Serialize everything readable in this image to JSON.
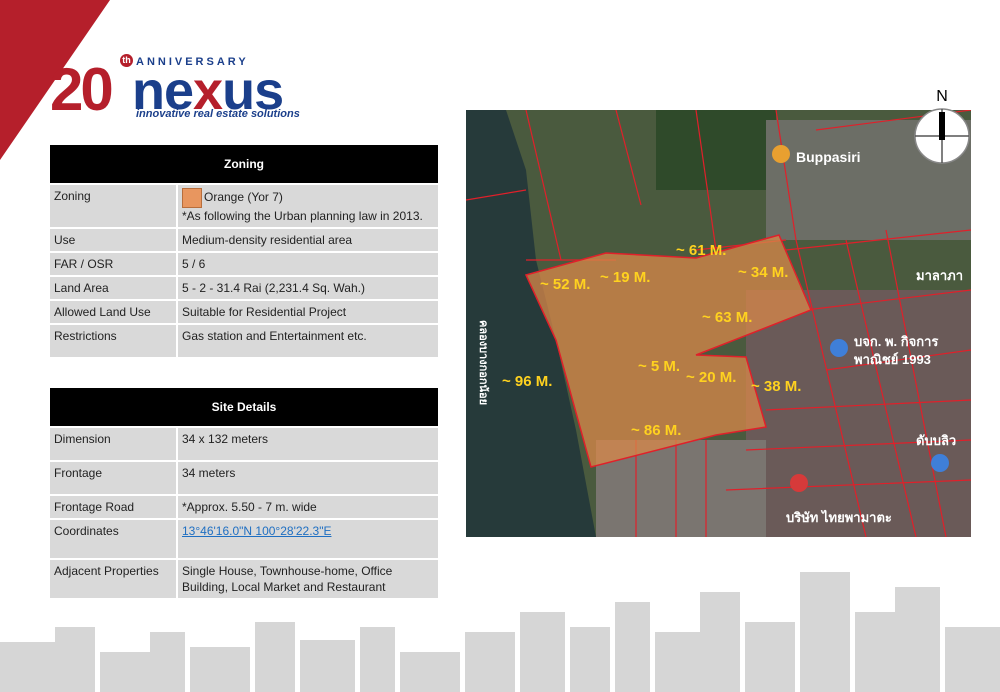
{
  "logo": {
    "number": "20",
    "superscript": "th",
    "anniversary": "ANNIVERSARY",
    "brand_pre": "ne",
    "brand_x": "x",
    "brand_post": "us",
    "tagline": "innovative real estate solutions"
  },
  "zoning_table": {
    "header": "Zoning",
    "rows": [
      {
        "key": "Zoning",
        "value": "Orange (Yor 7)",
        "note": "*As following the Urban planning law in 2013."
      },
      {
        "key": "Use",
        "value": "Medium-density residential area"
      },
      {
        "key": "FAR / OSR",
        "value": "5 / 6"
      },
      {
        "key": "Land Area",
        "value": "5 - 2 - 31.4 Rai (2,231.4 Sq. Wah.)"
      },
      {
        "key": "Allowed Land Use",
        "value": "Suitable for Residential Project"
      },
      {
        "key": "Restrictions",
        "value": "Gas station and Entertainment etc."
      }
    ]
  },
  "site_table": {
    "header": "Site Details",
    "rows": [
      {
        "key": "Dimension",
        "value": "34 x 132 meters"
      },
      {
        "key": "Frontage",
        "value": "34 meters"
      },
      {
        "key": "Frontage Road",
        "value": "*Approx. 5.50 - 7 m. wide"
      },
      {
        "key": "Coordinates",
        "value": "13°46'16.0\"N 100°28'22.3\"E"
      },
      {
        "key": "Adjacent Properties",
        "value": "Single House, Townhouse-home, Office Building, Local Market and Restaurant"
      }
    ]
  },
  "map": {
    "compass_label": "N",
    "poi_1": "Buppasiri",
    "thai_1": "บจก. พ. กิจการ",
    "thai_2": "พาณิชย์ 1993",
    "thai_3": "คลองบางกอกน้อย",
    "thai_4": "ดับบลิว",
    "thai_5": "บริษัท ไทยพามาตะ",
    "thai_6": "มาลาภา",
    "dimensions": [
      "~ 61 M.",
      "~ 52 M.",
      "~ 19 M.",
      "~ 34 M.",
      "~ 63 M.",
      "~ 96 M.",
      "~ 5 M.",
      "~ 20 M.",
      "~ 38 M.",
      "~ 86 M."
    ]
  },
  "colors": {
    "accent_red": "#b51f2b",
    "brand_blue": "#1b3f8b",
    "zone_orange": "#e8965f",
    "label_yellow": "#ffd21f"
  }
}
